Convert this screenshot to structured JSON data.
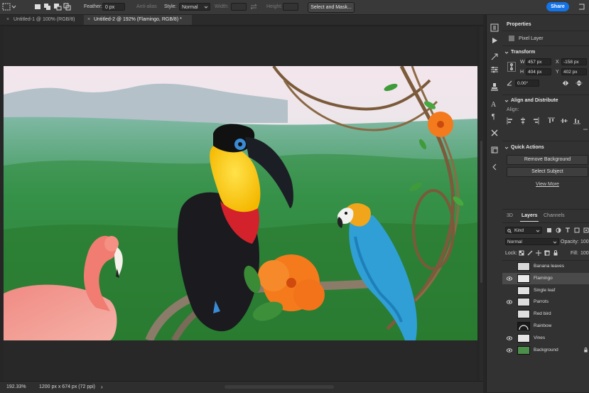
{
  "options_bar": {
    "feather_label": "Feather:",
    "feather_value": "0 px",
    "anti_alias_label": "Anti-alias",
    "style_label": "Style:",
    "style_value": "Normal",
    "width_label": "Width:",
    "height_label": "Height:",
    "select_and_mask_label": "Select and Mask...",
    "share_label": "Share"
  },
  "tabs": [
    {
      "label": "Untitled-1 @ 100% (RGB/8)",
      "close": "×"
    },
    {
      "label": "Untitled-2 @ 192% (Flamingo, RGB/8) *",
      "close": "×"
    }
  ],
  "status": {
    "zoom": "192.33%",
    "doc_info": "1200 px x 674 px (72 ppi)",
    "arrow": "›"
  },
  "panel": {
    "properties_title": "Properties",
    "pixel_layer_label": "Pixel Layer",
    "transform_title": "Transform",
    "w_label": "W",
    "w_value": "457 px",
    "x_label": "X",
    "x_value": "-158 px",
    "h_label": "H",
    "h_value": "404 px",
    "y_label": "Y",
    "y_value": "402 px",
    "angle_value": "0.00°",
    "align_title": "Align and Distribute",
    "align_label": "Align:",
    "quick_actions_title": "Quick Actions",
    "remove_bg_label": "Remove Background",
    "select_subject_label": "Select Subject",
    "view_more_label": "View More"
  },
  "layers_panel": {
    "tabs": [
      "3D",
      "Layers",
      "Channels"
    ],
    "kind_label": "Kind",
    "blend_mode": "Normal",
    "opacity_label": "Opacity:",
    "opacity_value": "100",
    "lock_label": "Lock:",
    "fill_label": "Fill:",
    "fill_value": "100",
    "layers": [
      {
        "name": "Banana leaves",
        "visible": false
      },
      {
        "name": "Flamingo",
        "visible": true,
        "selected": true
      },
      {
        "name": "Single leaf",
        "visible": false
      },
      {
        "name": "Parrots",
        "visible": true
      },
      {
        "name": "Red bird",
        "visible": false
      },
      {
        "name": "Rainbow",
        "visible": false
      },
      {
        "name": "Vines",
        "visible": true
      },
      {
        "name": "Background",
        "visible": true
      }
    ]
  },
  "colors": {
    "accent": "#1473e6",
    "panel_bg": "#323232",
    "app_bg": "#262626"
  }
}
